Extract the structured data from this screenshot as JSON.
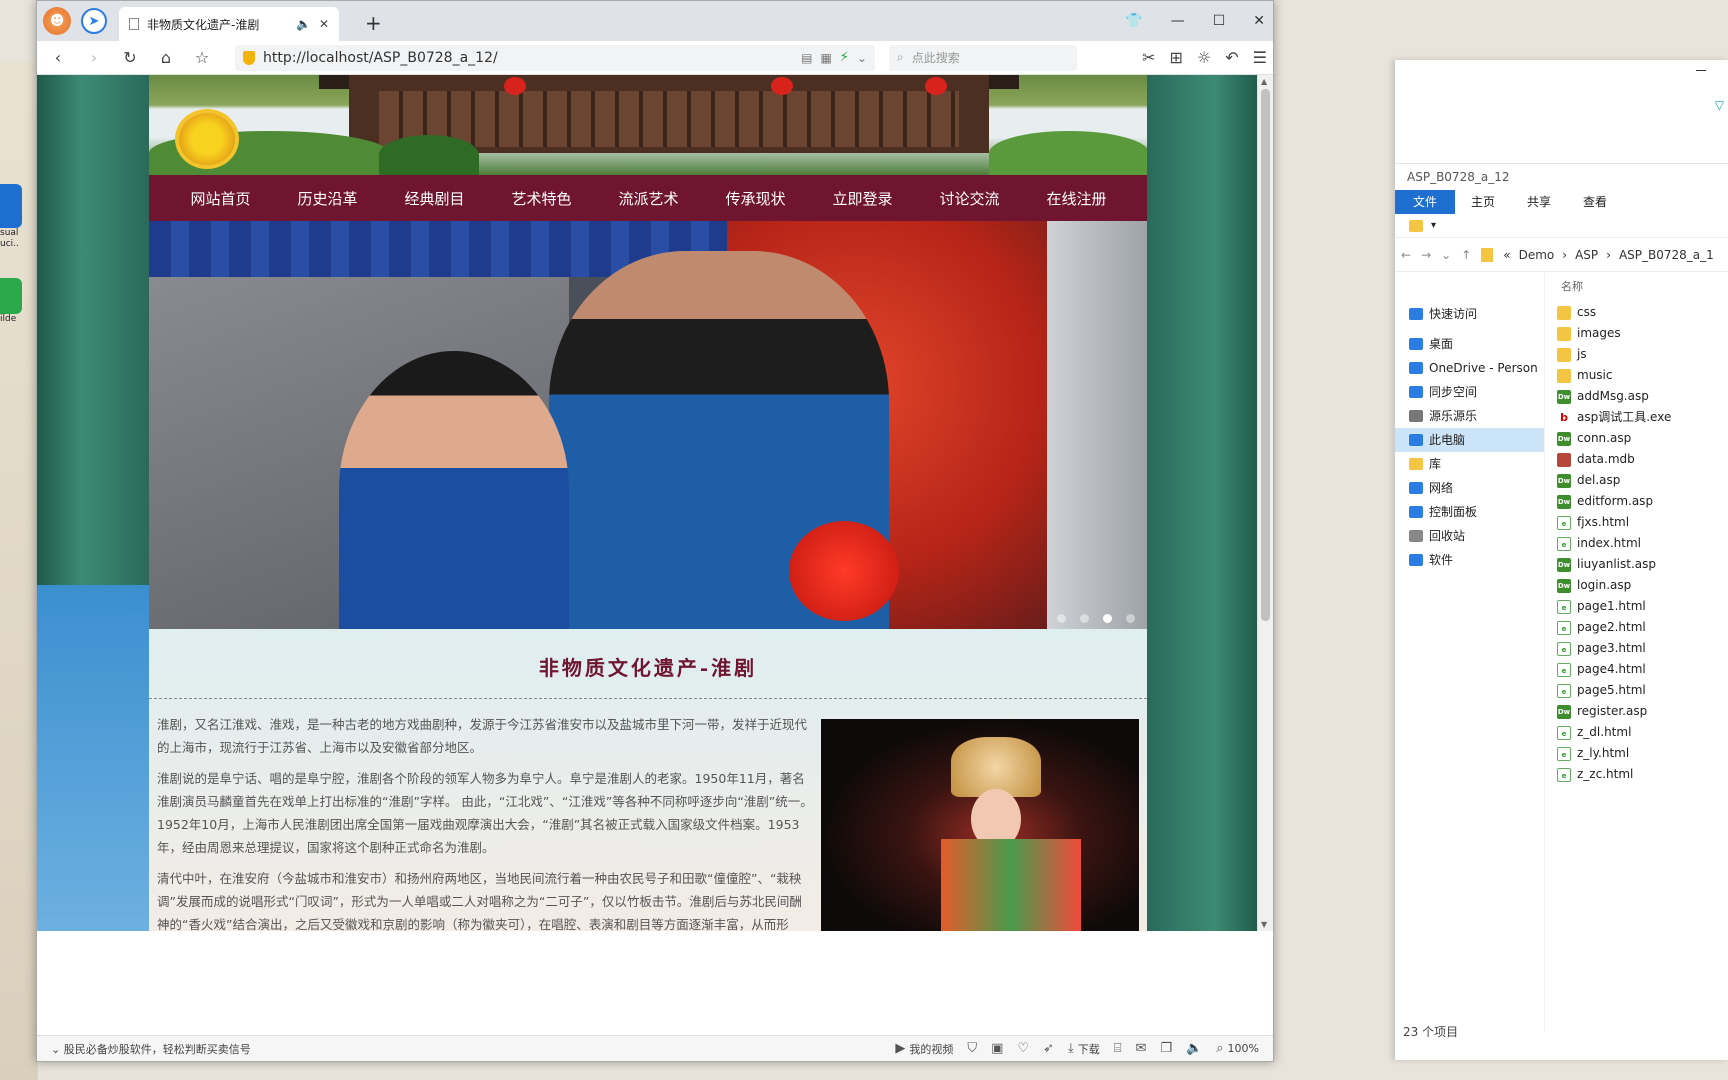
{
  "desktop": {
    "icons": [
      {
        "label": "isual\nuci...",
        "color": "#1e6fd0"
      },
      {
        "label": "ilde",
        "color": "#2aa84a"
      }
    ]
  },
  "explorer": {
    "title": "ASP_B0728_a_12",
    "ribbon": [
      "文件",
      "主页",
      "共享",
      "查看"
    ],
    "address": {
      "crumbs": [
        "«",
        "Demo",
        "›",
        "ASP",
        "›",
        "ASP_B0728_a_1"
      ]
    },
    "nav": [
      {
        "label": "快速访问",
        "icon": "star-icon",
        "color": "#2b7de1"
      },
      {
        "label": "桌面",
        "icon": "desktop-icon",
        "color": "#2b7de1"
      },
      {
        "label": "OneDrive - Person",
        "icon": "cloud-icon",
        "color": "#2b7de1"
      },
      {
        "label": "同步空间",
        "icon": "sync-icon",
        "color": "#2b7de1"
      },
      {
        "label": "源乐源乐",
        "icon": "user-icon",
        "color": "#777"
      },
      {
        "label": "此电脑",
        "icon": "computer-icon",
        "color": "#2b7de1",
        "selected": true
      },
      {
        "label": "库",
        "icon": "library-icon",
        "color": "#f4c542"
      },
      {
        "label": "网络",
        "icon": "network-icon",
        "color": "#2b7de1"
      },
      {
        "label": "控制面板",
        "icon": "control-panel-icon",
        "color": "#2b7de1"
      },
      {
        "label": "回收站",
        "icon": "recycle-bin-icon",
        "color": "#888"
      },
      {
        "label": "软件",
        "icon": "drive-icon",
        "color": "#2b7de1"
      }
    ],
    "column_header": "名称",
    "files": [
      {
        "name": "css",
        "type": "folder"
      },
      {
        "name": "images",
        "type": "folder"
      },
      {
        "name": "js",
        "type": "folder"
      },
      {
        "name": "music",
        "type": "folder"
      },
      {
        "name": "addMsg.asp",
        "type": "dw"
      },
      {
        "name": "asp调试工具.exe",
        "type": "exe"
      },
      {
        "name": "conn.asp",
        "type": "dw"
      },
      {
        "name": "data.mdb",
        "type": "mdb"
      },
      {
        "name": "del.asp",
        "type": "dw"
      },
      {
        "name": "editform.asp",
        "type": "dw"
      },
      {
        "name": "fjxs.html",
        "type": "html"
      },
      {
        "name": "index.html",
        "type": "html"
      },
      {
        "name": "liuyanlist.asp",
        "type": "dw"
      },
      {
        "name": "login.asp",
        "type": "dw"
      },
      {
        "name": "page1.html",
        "type": "html"
      },
      {
        "name": "page2.html",
        "type": "html"
      },
      {
        "name": "page3.html",
        "type": "html"
      },
      {
        "name": "page4.html",
        "type": "html"
      },
      {
        "name": "page5.html",
        "type": "html"
      },
      {
        "name": "register.asp",
        "type": "dw"
      },
      {
        "name": "z_dl.html",
        "type": "html"
      },
      {
        "name": "z_ly.html",
        "type": "html"
      },
      {
        "name": "z_zc.html",
        "type": "html"
      }
    ],
    "status": "23 个项目"
  },
  "browser": {
    "tab_title": "非物质文化遗产-淮剧",
    "url": "http://localhost/ASP_B0728_a_12/",
    "search_placeholder": "点此搜索"
  },
  "site": {
    "menu": [
      "网站首页",
      "历史沿革",
      "经典剧目",
      "艺术特色",
      "流派艺术",
      "传承现状",
      "立即登录",
      "讨论交流",
      "在线注册"
    ],
    "slider": {
      "dots": 4,
      "active": 2
    },
    "title": "非物质文化遗产-淮剧",
    "paragraphs": [
      "淮剧，又名江淮戏、淮戏，是一种古老的地方戏曲剧种，发源于今江苏省淮安市以及盐城市里下河一带，发祥于近现代的上海市，现流行于江苏省、上海市以及安徽省部分地区。",
      "淮剧说的是阜宁话、唱的是阜宁腔，淮剧各个阶段的领军人物多为阜宁人。阜宁是淮剧人的老家。1950年11月，著名淮剧演员马麟童首先在戏单上打出标准的“淮剧”字样。 由此，“江北戏”、“江淮戏”等各种不同称呼逐步向“淮剧”统一。1952年10月，上海市人民淮剧团出席全国第一届戏曲观摩演出大会，“淮剧”其名被正式载入国家级文件档案。1953年，经由周恩来总理提议，国家将这个剧种正式命名为淮剧。",
      "清代中叶，在淮安府（今盐城市和淮安市）和扬州府两地区，当地民间流行着一种由农民号子和田歌“僮僮腔”、“栽秧调”发展而成的说唱形式“门叹词”，形式为一人单唱或二人对唱称之为“二可子”，仅以竹板击节。淮剧后与苏北民间酬神的“香火戏”结合演出，之后又受徽戏和京剧的影响（称为徽夹可），在唱腔、表演和剧目等方面逐渐丰富，从而形"
    ]
  },
  "statusbar": {
    "news": "股民必备炒股软件，轻松判断买卖信号",
    "video": "我的视频",
    "download": "下载",
    "zoom": "100%"
  }
}
